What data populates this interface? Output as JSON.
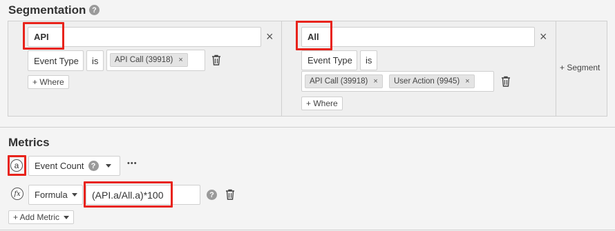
{
  "segmentation": {
    "title": "Segmentation",
    "help": "?",
    "segments": [
      {
        "name": "API",
        "filter": {
          "property": "Event Type",
          "operator": "is",
          "values": [
            "API Call (39918)"
          ]
        },
        "where_label": "+ Where"
      },
      {
        "name": "All",
        "filter": {
          "property": "Event Type",
          "operator": "is",
          "values": [
            "API Call (39918)",
            "User Action (9945)"
          ]
        },
        "where_label": "+ Where"
      }
    ],
    "add_segment_label": "+ Segment",
    "remove_glyph": "×",
    "chip_remove_glyph": "×"
  },
  "metrics": {
    "title": "Metrics",
    "items": [
      {
        "letter": "a",
        "name": "Event Count",
        "help": "?",
        "more": "•••"
      },
      {
        "letter": "fx",
        "type": "Formula",
        "formula": "(API.a/All.a)*100",
        "help": "?"
      }
    ],
    "add_metric_label": "+ Add Metric"
  },
  "colors": {
    "highlight": "#e8231b",
    "background": "#f4f4f4"
  }
}
